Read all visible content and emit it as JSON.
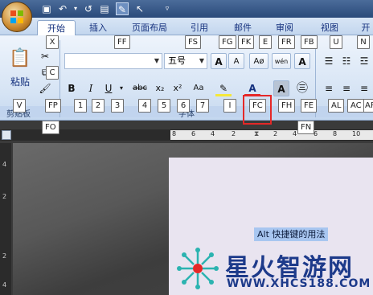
{
  "tabs": [
    "开始",
    "插入",
    "页面布局",
    "引用",
    "邮件",
    "审阅",
    "视图",
    "开"
  ],
  "ribbon": {
    "paste_label": "粘贴",
    "font_size": "五号",
    "font_name": "",
    "group_labels": {
      "clipboard": "剪贴板",
      "font": "字体"
    },
    "buttons": {
      "bold": "B",
      "italic": "I",
      "underline": "U",
      "strike": "abc",
      "subscript": "x₂",
      "superscript": "x²",
      "change_case": "Aa",
      "font_color": "A",
      "grow": "A",
      "shrink": "A",
      "wen": "wén",
      "border": "A",
      "char_shade": "A"
    }
  },
  "keytips": [
    {
      "id": "x",
      "label": "X"
    },
    {
      "id": "c",
      "label": "C"
    },
    {
      "id": "ff",
      "label": "FF"
    },
    {
      "id": "fs",
      "label": "FS"
    },
    {
      "id": "fg",
      "label": "FG"
    },
    {
      "id": "fk",
      "label": "FK"
    },
    {
      "id": "e",
      "label": "E"
    },
    {
      "id": "fr",
      "label": "FR"
    },
    {
      "id": "fb",
      "label": "FB"
    },
    {
      "id": "u2",
      "label": "U"
    },
    {
      "id": "n",
      "label": "N"
    },
    {
      "id": "v",
      "label": "V"
    },
    {
      "id": "fp",
      "label": "FP"
    },
    {
      "id": "k1",
      "label": "1"
    },
    {
      "id": "k2",
      "label": "2"
    },
    {
      "id": "k3",
      "label": "3"
    },
    {
      "id": "k4",
      "label": "4"
    },
    {
      "id": "k5",
      "label": "5"
    },
    {
      "id": "k6",
      "label": "6"
    },
    {
      "id": "k7",
      "label": "7"
    },
    {
      "id": "i",
      "label": "I"
    },
    {
      "id": "fc",
      "label": "FC"
    },
    {
      "id": "fh",
      "label": "FH"
    },
    {
      "id": "fe",
      "label": "FE"
    },
    {
      "id": "al",
      "label": "AL"
    },
    {
      "id": "ac",
      "label": "AC"
    },
    {
      "id": "ar",
      "label": "AR"
    },
    {
      "id": "fo",
      "label": "FO"
    },
    {
      "id": "fn",
      "label": "FN"
    }
  ],
  "ruler": {
    "numbers": [
      "8",
      "6",
      "4",
      "2",
      "2",
      "4",
      "6",
      "8",
      "10"
    ]
  },
  "vruler": {
    "numbers": [
      "4",
      "2",
      "2",
      "4"
    ]
  },
  "document": {
    "selected_text": "Alt 快捷键的用法"
  },
  "watermark": {
    "name": "星火智游网",
    "url": "WWW.XHCS188.COM"
  },
  "colors": {
    "accent": "#15317e",
    "highlight": "#e52828",
    "selection": "#a8c6f0"
  }
}
